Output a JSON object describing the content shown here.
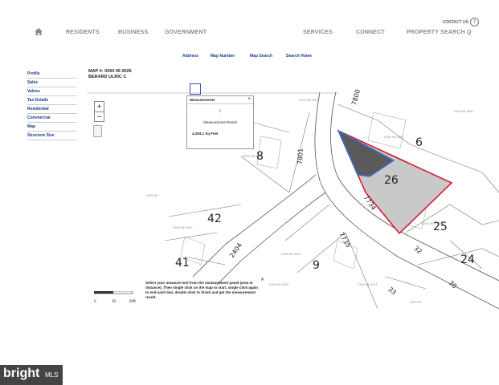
{
  "header": {
    "contact_label": "CONTACT US",
    "help_label": "?",
    "nav": [
      {
        "label": "RESIDENTS"
      },
      {
        "label": "BUSINESS"
      },
      {
        "label": "GOVERNMENT"
      },
      {
        "label": "SERVICES"
      },
      {
        "label": "CONNECT"
      },
      {
        "label": "PROPERTY SEARCH Q"
      }
    ]
  },
  "search_tabs": [
    {
      "label": "Address"
    },
    {
      "label": "Map Number"
    },
    {
      "label": "Map Search"
    },
    {
      "label": "Search Home"
    }
  ],
  "sidebar": {
    "items": [
      {
        "label": "Profile"
      },
      {
        "label": "Sales"
      },
      {
        "label": "Values"
      },
      {
        "label": "Tax Details"
      },
      {
        "label": "Residential"
      },
      {
        "label": "Commercial"
      },
      {
        "label": "Map"
      },
      {
        "label": "Structure Size"
      }
    ]
  },
  "map_header": {
    "map_number": "MAP #: 0394 06 0026",
    "owner": "BERARD ULRIC C"
  },
  "zoom": {
    "plus": "+",
    "minus": "−"
  },
  "measurements": {
    "title": "Measurements",
    "close": "×",
    "cursor": "I",
    "result_label": "Measurement Result",
    "result_value": "4,294.1 Sq Feet"
  },
  "map": {
    "lot_numbers": [
      "6",
      "8",
      "26",
      "25",
      "42",
      "41",
      "9",
      "24"
    ],
    "street_numbers": [
      "7800",
      "7801",
      "7734",
      "7735",
      "2404",
      "32",
      "33",
      "30"
    ]
  },
  "scale": {
    "ticks": [
      "0",
      "30",
      "60ft"
    ]
  },
  "instructions": {
    "text": "Select your measure tool from the measurement panel (area or distance). Then single click on the map to start, single click again to end each line, double click to finish and get the measurement result.",
    "close": "×"
  },
  "watermark": {
    "text": "bright",
    "suffix": "MLS"
  }
}
